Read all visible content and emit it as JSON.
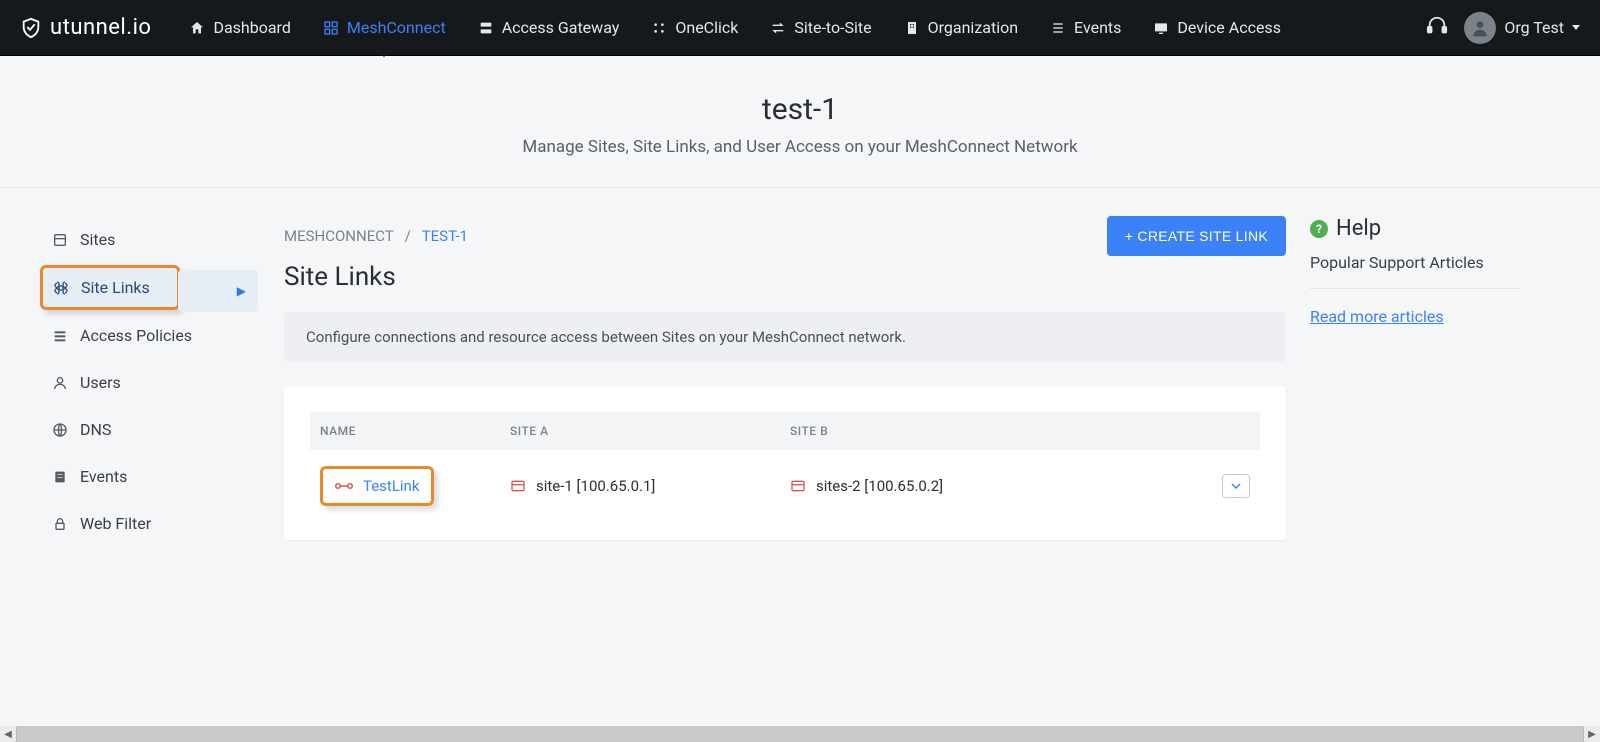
{
  "brand": "utunnel.io",
  "nav": {
    "items": [
      {
        "label": "Dashboard"
      },
      {
        "label": "MeshConnect"
      },
      {
        "label": "Access Gateway"
      },
      {
        "label": "OneClick"
      },
      {
        "label": "Site-to-Site"
      },
      {
        "label": "Organization"
      },
      {
        "label": "Events"
      },
      {
        "label": "Device Access"
      }
    ],
    "user": "Org Test"
  },
  "header": {
    "title": "test-1",
    "subtitle": "Manage Sites, Site Links, and User Access on your MeshConnect Network"
  },
  "sidebar": {
    "items": [
      {
        "label": "Sites"
      },
      {
        "label": "Site Links"
      },
      {
        "label": "Access Policies"
      },
      {
        "label": "Users"
      },
      {
        "label": "DNS"
      },
      {
        "label": "Events"
      },
      {
        "label": "Web Filter"
      }
    ]
  },
  "breadcrumb": {
    "root": "MESHCONNECT",
    "sep": "/",
    "current": "TEST-1"
  },
  "buttons": {
    "create": "+ CREATE SITE LINK"
  },
  "section": {
    "title": "Site Links",
    "banner": "Configure connections and resource access between Sites on your MeshConnect network."
  },
  "table": {
    "headers": {
      "name": "NAME",
      "a": "SITE A",
      "b": "SITE B"
    },
    "rows": [
      {
        "name": "TestLink",
        "a": "site-1 [100.65.0.1]",
        "b": "sites-2 [100.65.0.2]"
      }
    ]
  },
  "help": {
    "title": "Help",
    "subtitle": "Popular Support Articles",
    "link": "Read more articles"
  }
}
